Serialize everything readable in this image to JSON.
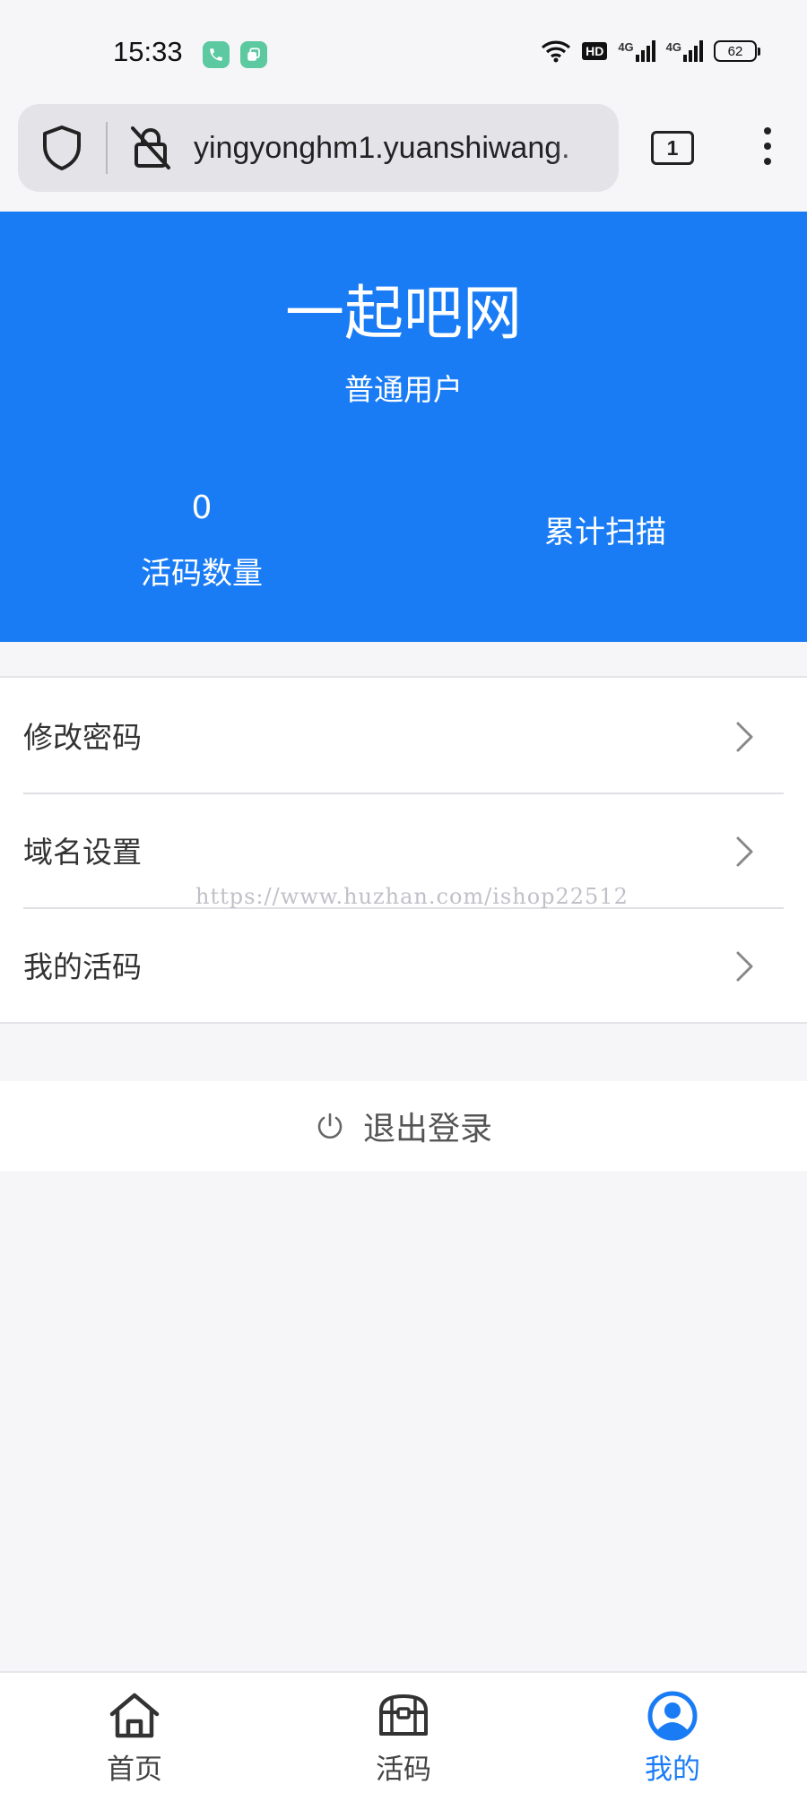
{
  "status_bar": {
    "time": "15:33",
    "network_badge": "HD",
    "signal_1": "4G",
    "signal_2": "4G",
    "battery": "62"
  },
  "browser": {
    "url": "yingyonghm1.yuanshiwang.",
    "tab_count": "1"
  },
  "header": {
    "title": "一起吧网",
    "subtitle": "普通用户",
    "stats": [
      {
        "value": "0",
        "label": "活码数量"
      },
      {
        "value": "",
        "label": "累计扫描"
      }
    ],
    "background_color": "#1a7cf5"
  },
  "menu": {
    "items": [
      {
        "label": "修改密码",
        "icon": "chevron-right-icon"
      },
      {
        "label": "域名设置",
        "icon": "chevron-right-icon"
      },
      {
        "label": "我的活码",
        "icon": "chevron-right-icon"
      }
    ]
  },
  "watermark": "https://www.huzhan.com/ishop22512",
  "logout": {
    "label": "退出登录",
    "icon": "power-icon"
  },
  "tabbar": {
    "items": [
      {
        "label": "首页",
        "icon": "home-icon",
        "active": false
      },
      {
        "label": "活码",
        "icon": "chest-icon",
        "active": false
      },
      {
        "label": "我的",
        "icon": "user-icon",
        "active": true
      }
    ],
    "active_color": "#1a7cf5"
  }
}
